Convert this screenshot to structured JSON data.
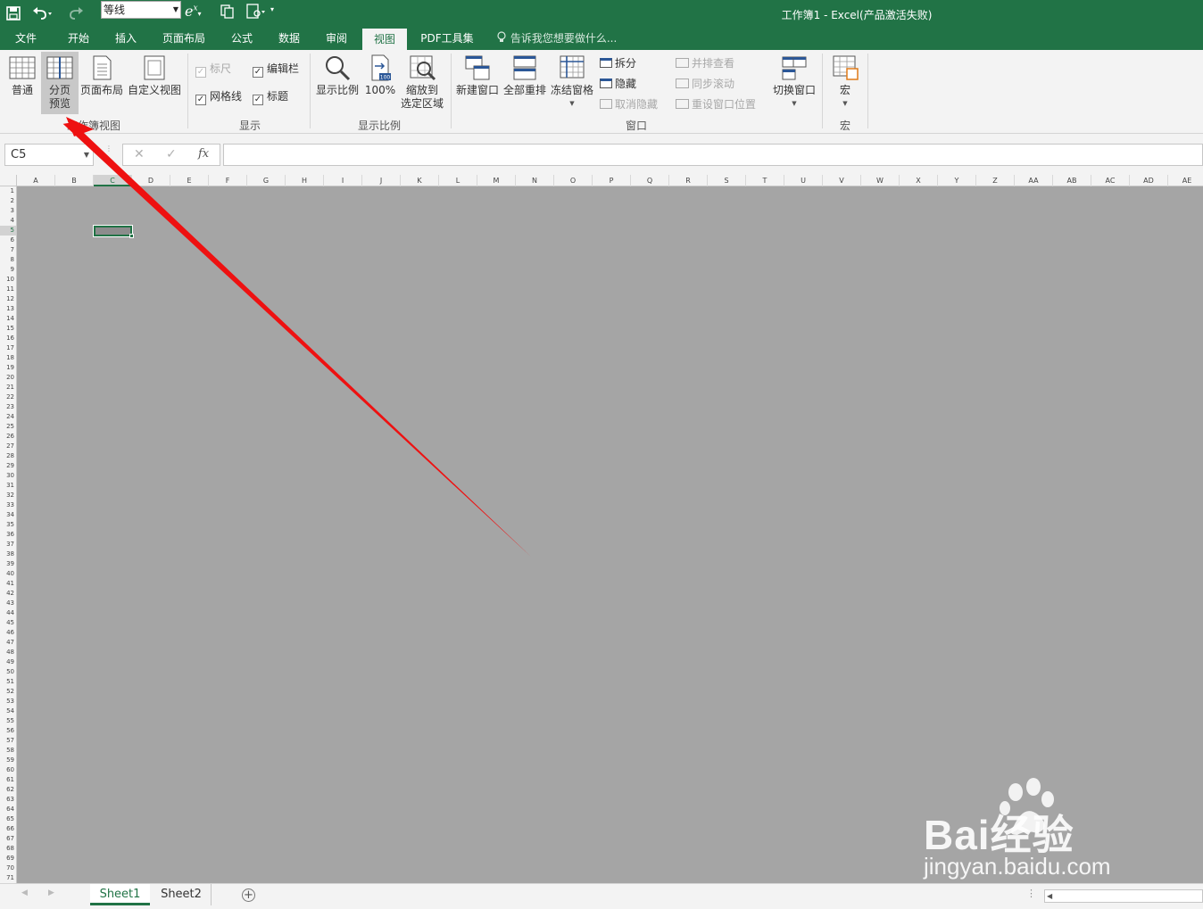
{
  "title_bar": {
    "font_name": "等线",
    "window_title": "工作簿1 - Excel(产品激活失败)"
  },
  "tabs": [
    {
      "label": "文件"
    },
    {
      "label": "开始"
    },
    {
      "label": "插入"
    },
    {
      "label": "页面布局"
    },
    {
      "label": "公式"
    },
    {
      "label": "数据"
    },
    {
      "label": "审阅"
    },
    {
      "label": "视图",
      "active": true
    },
    {
      "label": "PDF工具集"
    }
  ],
  "tell_me": "告诉我您想要做什么...",
  "ribbon": {
    "workbook_views": {
      "label": "工作簿视图",
      "normal": "普通",
      "page_break_preview_1": "分页",
      "page_break_preview_2": "预览",
      "page_layout": "页面布局",
      "custom_views": "自定义视图"
    },
    "show": {
      "label": "显示",
      "ruler": "标尺",
      "formula_bar": "编辑栏",
      "gridlines": "网格线",
      "headings": "标题"
    },
    "zoom": {
      "label": "显示比例",
      "zoom": "显示比例",
      "zoom_100": "100%",
      "zoom_100_badge": "100",
      "zoom_sel_1": "缩放到",
      "zoom_sel_2": "选定区域"
    },
    "window": {
      "label": "窗口",
      "new_window": "新建窗口",
      "arrange_all": "全部重排",
      "freeze_panes": "冻结窗格",
      "split": "拆分",
      "hide": "隐藏",
      "unhide": "取消隐藏",
      "side_by_side": "并排查看",
      "sync_scroll": "同步滚动",
      "reset_pos": "重设窗口位置",
      "switch_windows": "切换窗口"
    },
    "macros": {
      "label": "宏",
      "macros": "宏"
    }
  },
  "formula_bar": {
    "name_box": "C5",
    "fx": "fx",
    "value": ""
  },
  "columns": [
    "A",
    "B",
    "C",
    "D",
    "E",
    "F",
    "G",
    "H",
    "I",
    "J",
    "K",
    "L",
    "M",
    "N",
    "O",
    "P",
    "Q",
    "R",
    "S",
    "T",
    "U",
    "V",
    "W",
    "X",
    "Y",
    "Z",
    "AA",
    "AB",
    "AC",
    "AD",
    "AE"
  ],
  "row_count": 71,
  "selected_cell": "C5",
  "sheets": [
    {
      "name": "Sheet1",
      "active": true
    },
    {
      "name": "Sheet2",
      "active": false
    }
  ],
  "colors": {
    "excel_green": "#217346",
    "ribbon_bg": "#f3f3f3",
    "grid_bg": "#a5a5a5",
    "arrow_red": "#ee1111"
  },
  "watermark": {
    "brand": "Bai经验",
    "url": "jingyan.baidu.com"
  }
}
